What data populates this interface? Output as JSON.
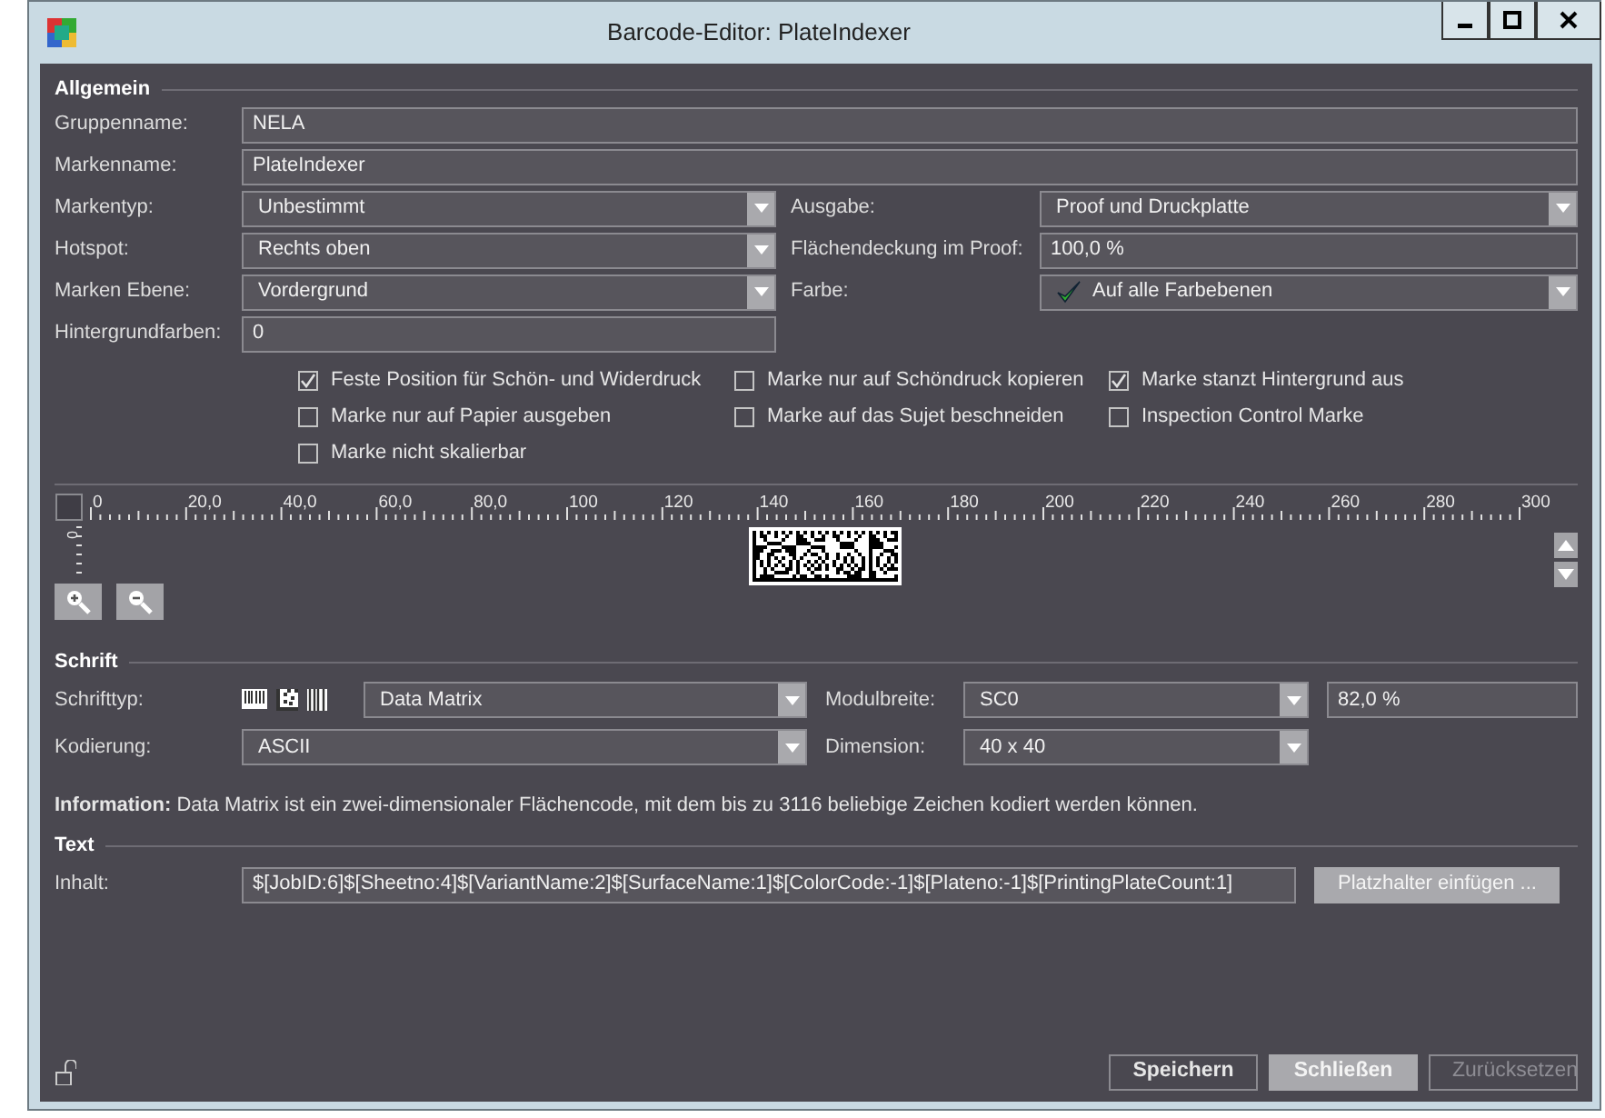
{
  "window": {
    "title": "Barcode-Editor: PlateIndexer"
  },
  "general": {
    "heading": "Allgemein",
    "name_fields": [
      {
        "label": "Gruppenname:",
        "value": "NELA"
      },
      {
        "label": "Markenname:",
        "value": "PlateIndexer"
      }
    ],
    "property_rows": [
      [
        {
          "label": "Markentyp:",
          "value": "Unbestimmt",
          "kind": "combo"
        },
        {
          "label": "Ausgabe:",
          "value": "Proof und Druckplatte",
          "kind": "combo"
        }
      ],
      [
        {
          "label": "Hotspot:",
          "value": "Rechts oben",
          "kind": "combo"
        },
        {
          "label": "Flächendeckung im Proof:",
          "value": "100,0 %",
          "kind": "text"
        }
      ],
      [
        {
          "label": "Marken Ebene:",
          "value": "Vordergrund",
          "kind": "combo"
        },
        {
          "label": "Farbe:",
          "value": "Auf alle Farbebenen",
          "kind": "checkcombo"
        }
      ],
      [
        {
          "label": "Hintergrundfarben:",
          "value": "0",
          "kind": "text"
        }
      ]
    ],
    "checkboxes": [
      {
        "label": "Feste Position für Schön- und Widerdruck",
        "checked": true
      },
      {
        "label": "Marke nur auf Schöndruck kopieren",
        "checked": false
      },
      {
        "label": "Marke stanzt Hintergrund aus",
        "checked": true
      },
      {
        "label": "Marke nur auf Papier ausgeben",
        "checked": false
      },
      {
        "label": "Marke auf das Sujet beschneiden",
        "checked": false
      },
      {
        "label": "Inspection Control Marke",
        "checked": false
      },
      {
        "label": "Marke nicht skalierbar",
        "checked": false
      }
    ]
  },
  "ruler": {
    "x_labels": [
      "0",
      "20,0",
      "40,0",
      "60,0",
      "80,0",
      "100",
      "120",
      "140",
      "160",
      "180",
      "200",
      "220",
      "240",
      "260",
      "280",
      "300"
    ],
    "y_labels": [
      "0"
    ]
  },
  "font": {
    "heading": "Schrift",
    "type": {
      "label": "Schrifttyp:",
      "value": "Data Matrix"
    },
    "module_width": {
      "label": "Modulbreite:",
      "value": "SC0",
      "percent": "82,0 %"
    },
    "encoding": {
      "label": "Kodierung:",
      "value": "ASCII"
    },
    "dimension": {
      "label": "Dimension:",
      "value": "40 x 40"
    }
  },
  "information": "**Information:** Data Matrix ist ein zwei-dimensionaler Flächencode, mit dem bis zu 3116 beliebige Zeichen kodiert werden können.",
  "text": {
    "heading": "Text",
    "label": "Inhalt:",
    "value": "$[JobID:6]$[Sheetno:4]$[VariantName:2]$[SurfaceName:1]$[ColorCode:-1]$[Plateno:-1]$[PrintingPlateCount:1]",
    "button": "Platzhalter einfügen ..."
  },
  "buttons": [
    {
      "label": "Speichern",
      "default": false,
      "disabled": false
    },
    {
      "label": "Schließen",
      "default": true,
      "disabled": false
    },
    {
      "label": "Zurücksetzen",
      "default": false,
      "disabled": true
    }
  ]
}
